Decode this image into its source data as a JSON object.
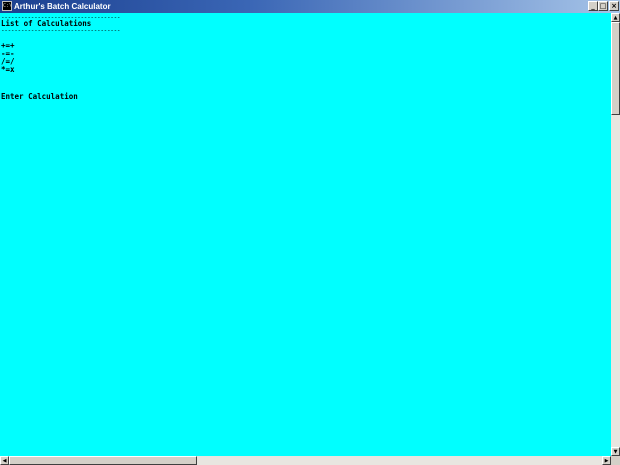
{
  "window": {
    "title": "Arthur's Batch Calculator",
    "icon_label": "C:\\"
  },
  "title_buttons": {
    "minimize": "_",
    "maximize": "□",
    "close": "×"
  },
  "console": {
    "background_color": "#00ffff",
    "text_color": "#000000",
    "rule_top": "------------------------------------",
    "heading": "List of Calculations",
    "rule_bottom": "------------------------------------",
    "operations": [
      "+=+",
      "-=-",
      "/=/",
      "*=x"
    ],
    "prompt": "Enter Calculation"
  },
  "scrollbars": {
    "up_arrow": "▲",
    "down_arrow": "▼",
    "left_arrow": "◀",
    "right_arrow": "▶"
  }
}
